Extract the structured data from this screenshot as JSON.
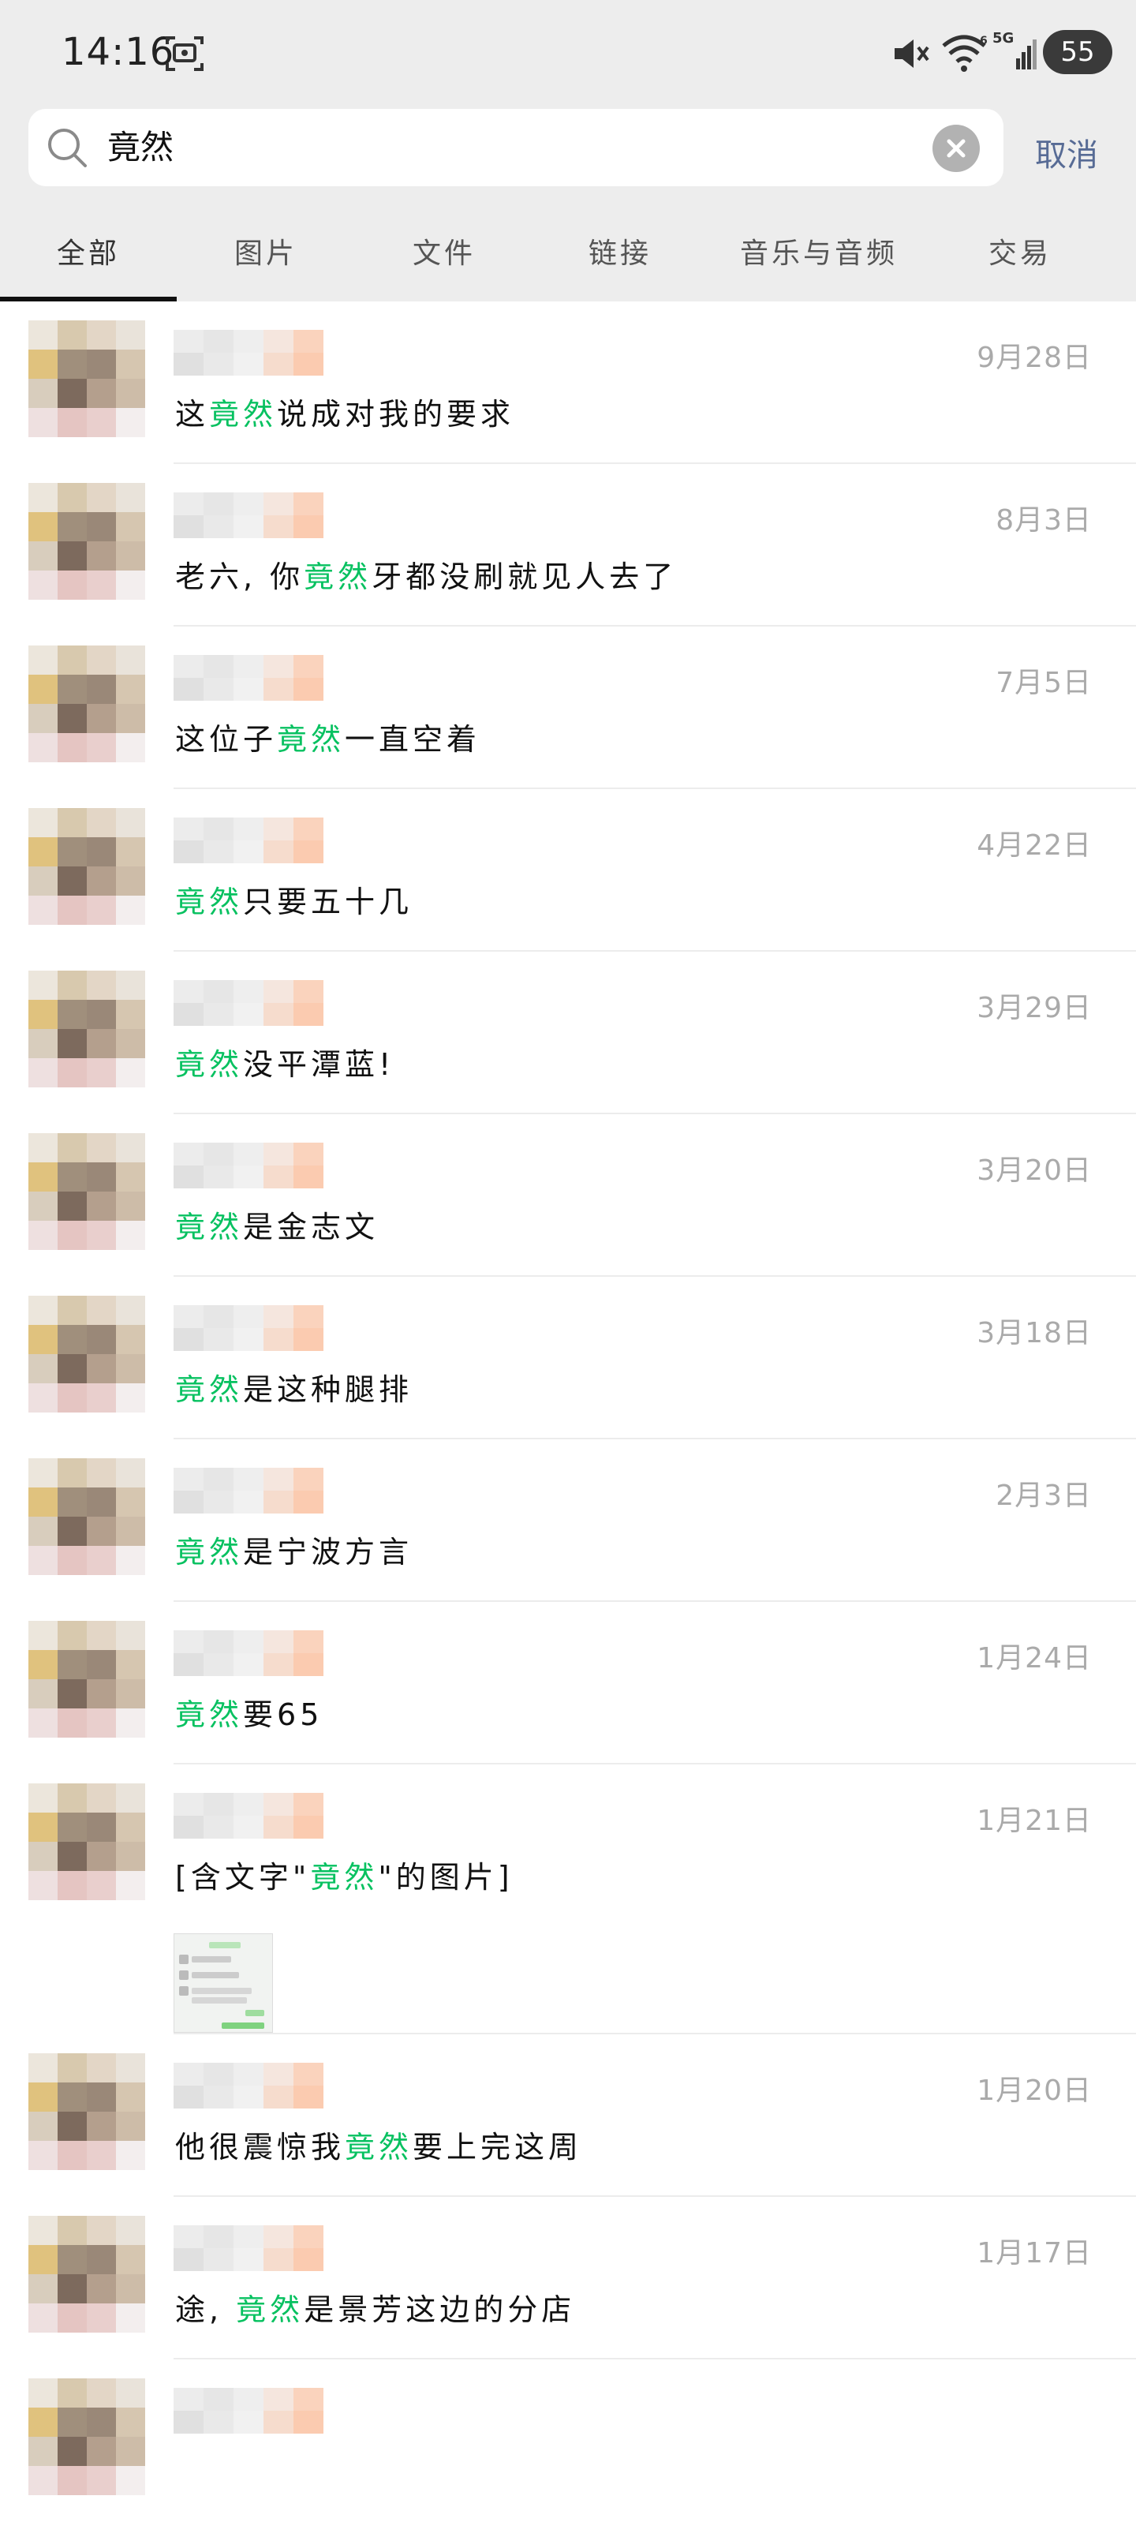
{
  "status_bar": {
    "time": "14:16",
    "network_type": "5G",
    "battery": "55",
    "icons": [
      "screen-record-icon",
      "mute-icon",
      "wifi-icon",
      "signal-icon"
    ]
  },
  "search": {
    "query": "竟然",
    "cancel_label": "取消"
  },
  "tabs": [
    {
      "label": "全部",
      "active": true
    },
    {
      "label": "图片"
    },
    {
      "label": "文件"
    },
    {
      "label": "链接"
    },
    {
      "label": "音乐与音频"
    },
    {
      "label": "交易"
    }
  ],
  "colors": {
    "highlight": "#07c160",
    "link_blue": "#576b95",
    "background_gray": "#ededed",
    "date_gray": "#aaaaaa"
  },
  "results": [
    {
      "date": "9月28日",
      "snippet": [
        "这",
        "竟然",
        "说成对我的要求"
      ]
    },
    {
      "date": "8月3日",
      "snippet": [
        "老六, 你",
        "竟然",
        "牙都没刷就见人去了"
      ]
    },
    {
      "date": "7月5日",
      "snippet": [
        "这位子",
        "竟然",
        "一直空着"
      ]
    },
    {
      "date": "4月22日",
      "snippet": [
        "",
        "竟然",
        "只要五十几"
      ]
    },
    {
      "date": "3月29日",
      "snippet": [
        "",
        "竟然",
        "没平潭蓝!"
      ]
    },
    {
      "date": "3月20日",
      "snippet": [
        "",
        "竟然",
        "是金志文"
      ]
    },
    {
      "date": "3月18日",
      "snippet": [
        "",
        "竟然",
        "是这种腿排"
      ]
    },
    {
      "date": "2月3日",
      "snippet": [
        "",
        "竟然",
        "是宁波方言"
      ]
    },
    {
      "date": "1月24日",
      "snippet": [
        "",
        "竟然",
        "要65"
      ]
    },
    {
      "date": "1月21日",
      "snippet": [
        "[含文字\"",
        "竟然",
        "\"的图片]"
      ],
      "has_image": true
    },
    {
      "date": "1月20日",
      "snippet": [
        "他很震惊我",
        "竟然",
        "要上完这周"
      ]
    },
    {
      "date": "1月17日",
      "snippet": [
        "途, ",
        "竟然",
        "是景芳这边的分店"
      ]
    },
    {
      "date": "",
      "snippet": [
        "",
        "",
        ""
      ]
    }
  ]
}
